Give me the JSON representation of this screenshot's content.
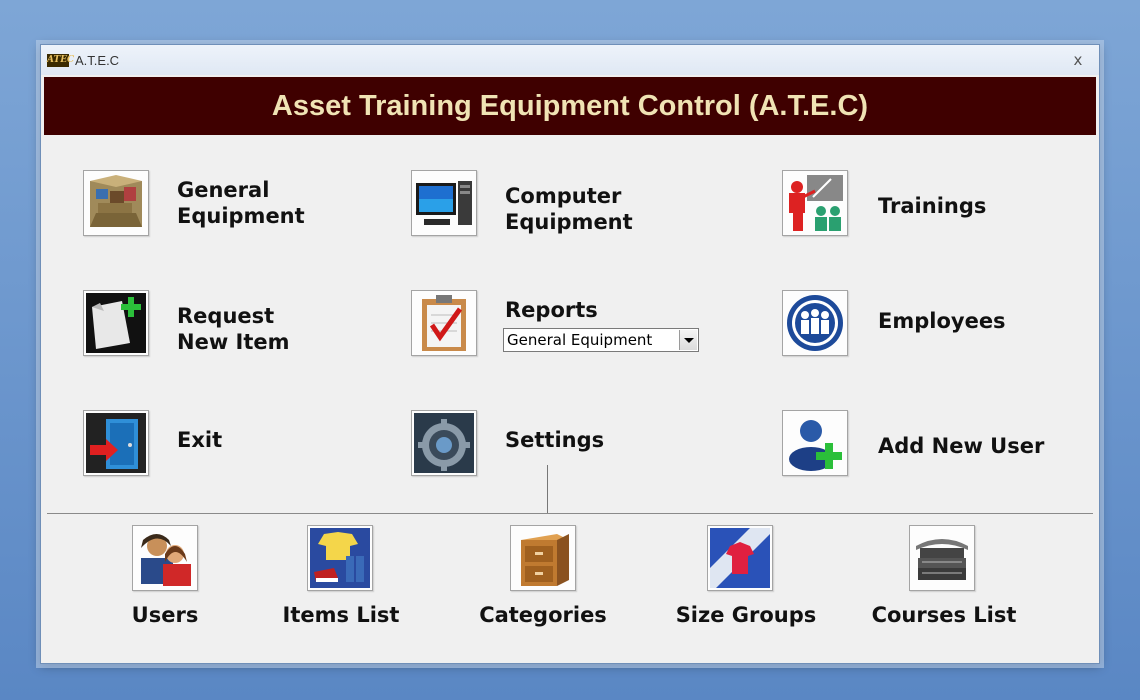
{
  "window": {
    "title": "A.T.E.C",
    "logo_text": "ATEC",
    "close_glyph": "x"
  },
  "banner": {
    "title": "Asset Training Equipment Control (A.T.E.C)",
    "background": "#3f0000",
    "text_color": "#f0e3b4"
  },
  "main_menu": {
    "general_equipment": {
      "line1": "General",
      "line2": "Equipment",
      "icon": "boxes-icon"
    },
    "computer_equipment": {
      "line1": "Computer",
      "line2": "Equipment",
      "icon": "computer-icon"
    },
    "trainings": {
      "label": "Trainings",
      "icon": "presentation-icon"
    },
    "request_new_item": {
      "line1": "Request",
      "line2": "New Item",
      "icon": "paper-plus-icon"
    },
    "reports": {
      "label": "Reports",
      "icon": "clipboard-check-icon",
      "select_value": "General Equipment"
    },
    "employees": {
      "label": "Employees",
      "icon": "group-badge-icon"
    },
    "exit": {
      "label": "Exit",
      "icon": "door-exit-icon"
    },
    "settings": {
      "label": "Settings",
      "icon": "gear-icon"
    },
    "add_new_user": {
      "label": "Add New User",
      "icon": "user-add-icon"
    }
  },
  "settings_menu": {
    "users": {
      "label": "Users",
      "icon": "users-icon"
    },
    "items_list": {
      "label": "Items List",
      "icon": "clothing-icon"
    },
    "categories": {
      "label": "Categories",
      "icon": "file-cabinet-icon"
    },
    "size_groups": {
      "label": "Size Groups",
      "icon": "size-shirt-icon"
    },
    "courses_list": {
      "label": "Courses List",
      "icon": "books-icon"
    }
  }
}
